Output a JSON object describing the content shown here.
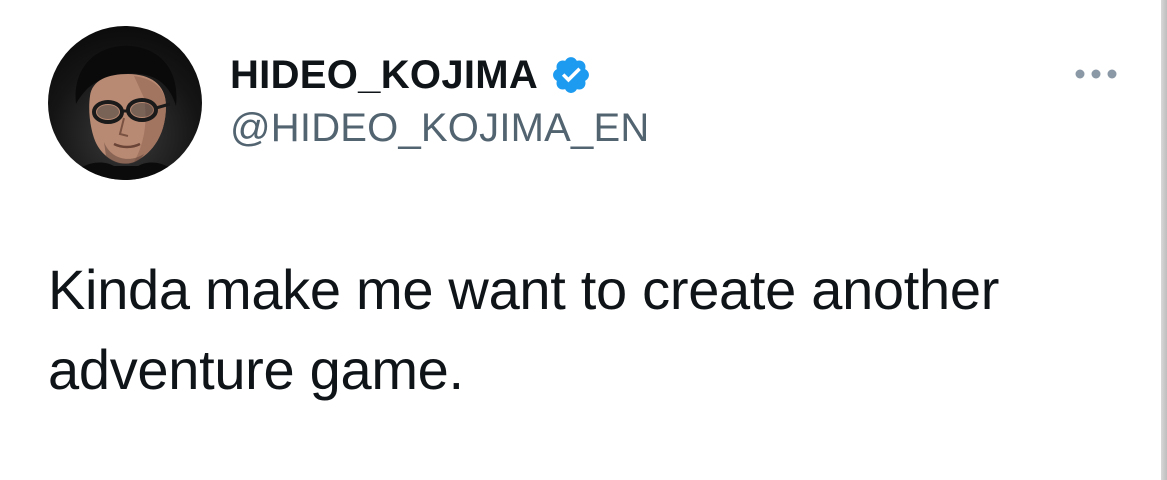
{
  "tweet": {
    "author": {
      "display_name": "HIDEO_KOJIMA",
      "handle": "@HIDEO_KOJIMA_EN",
      "verified": true,
      "avatar_icon": "profile-photo"
    },
    "text": "Kinda make me want to create another adventure game.",
    "more_icon": "more-horizontal-icon"
  },
  "colors": {
    "text_primary": "#0f1419",
    "text_secondary": "#536471",
    "verified_blue": "#1d9bf0",
    "more_gray": "#8b98a5"
  }
}
